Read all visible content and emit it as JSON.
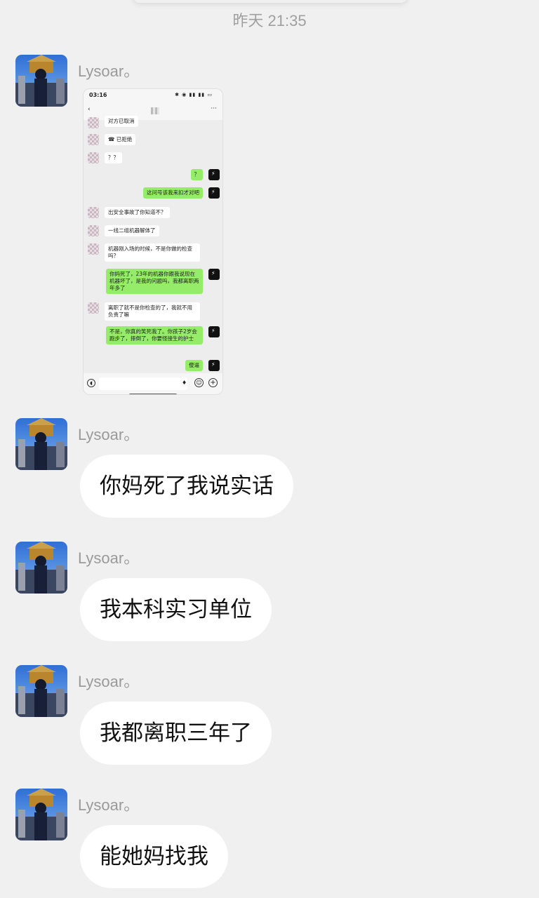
{
  "timestamp": "昨天 21:35",
  "messages": [
    {
      "sender": "Lysoar。",
      "type": "image"
    },
    {
      "sender": "Lysoar。",
      "text": "你妈死了我说实话"
    },
    {
      "sender": "Lysoar。",
      "text": "我本科实习单位"
    },
    {
      "sender": "Lysoar。",
      "text": "我都离职三年了"
    },
    {
      "sender": "Lysoar。",
      "text": "能她妈找我"
    }
  ],
  "screenshot": {
    "status_time": "03:16",
    "status_icons": "✱ ◉ ▮▮ ▮▮ ▭",
    "chat": [
      {
        "dir": "in",
        "text": "对方已取消"
      },
      {
        "dir": "in",
        "text": "☎ 已拒绝"
      },
      {
        "dir": "in",
        "text": "？？"
      },
      {
        "dir": "out",
        "text": "？"
      },
      {
        "dir": "out",
        "text": "这问号该我来扣才对吧"
      },
      {
        "dir": "in",
        "text": "出安全事故了你知道不？"
      },
      {
        "dir": "in",
        "text": "一线二组机器解体了"
      },
      {
        "dir": "in",
        "text": "机器刚入场的时候，不是你做的检查吗？"
      },
      {
        "dir": "out",
        "text": "你妈死了，23年的机器你跟我说现在机器坏了，是我的问题吗，我都离职两年多了"
      },
      {
        "dir": "in",
        "text": "离职了就不是你检查的了，我就不用负责了嘛"
      },
      {
        "dir": "out",
        "text": "不是，你真的笑死我了。你孩子2岁会跑步了，摔倒了，你要怪接生的护士"
      },
      {
        "dir": "out",
        "text": "傻逼"
      }
    ]
  }
}
